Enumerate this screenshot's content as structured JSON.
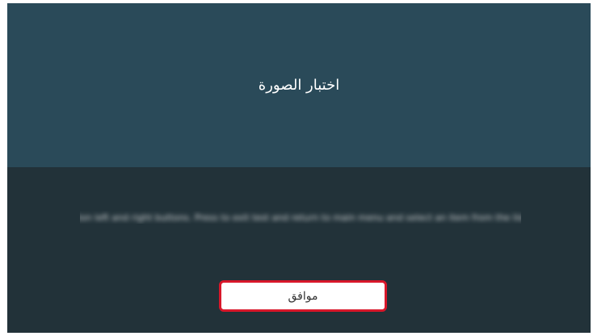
{
  "dialog": {
    "title": "اختبار الصورة",
    "message": "Use navigation left and right buttons. Press to exit test and return to main menu and select an item from the list of options.",
    "ok_label": "موافق"
  },
  "colors": {
    "header_background": "#2a4a59",
    "body_background": "#223239",
    "button_background": "#ffffff",
    "button_focus_border": "#d8172a"
  }
}
